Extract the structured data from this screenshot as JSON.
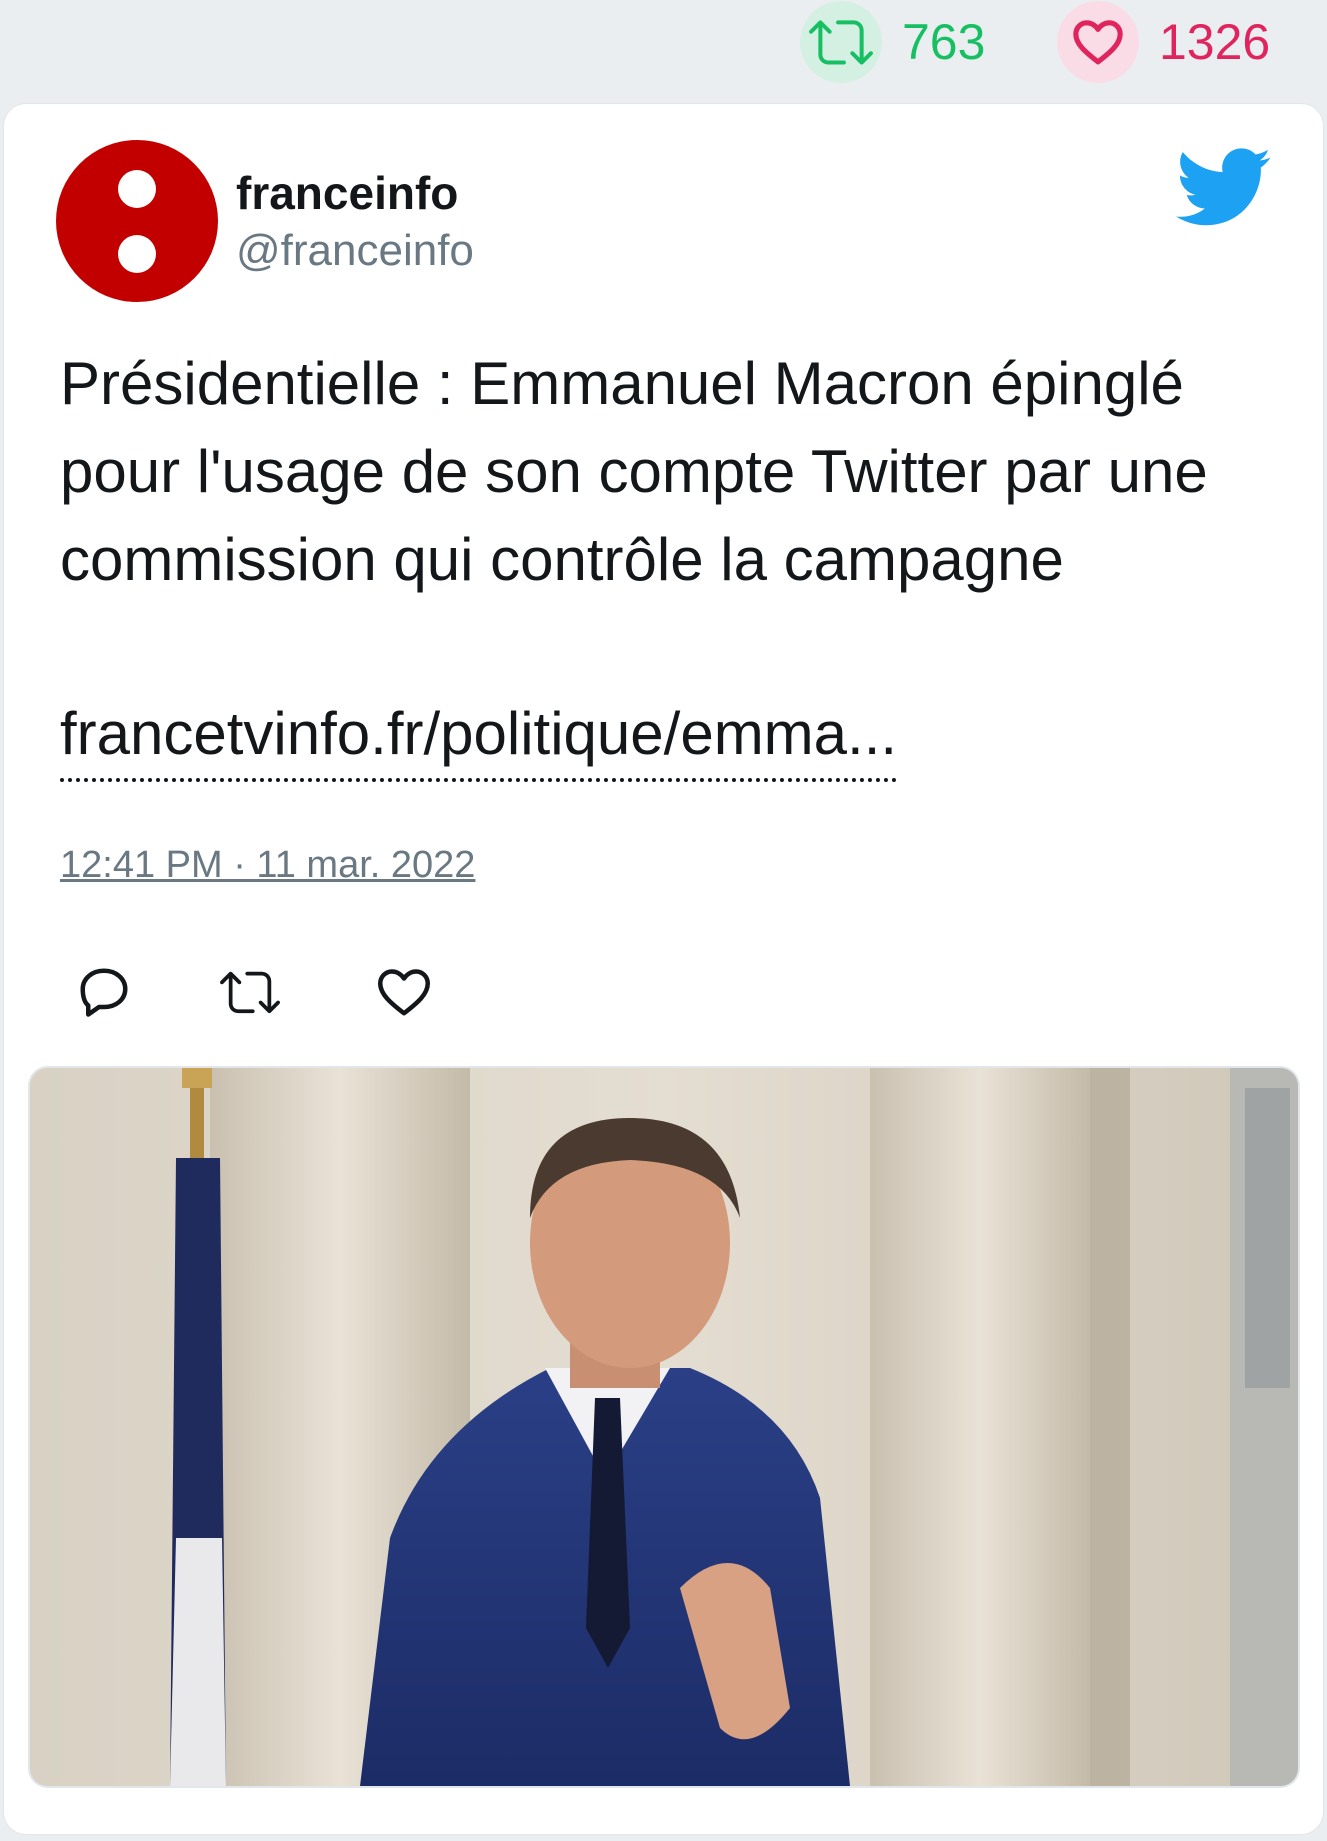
{
  "stats": {
    "retweets": "763",
    "likes": "1326"
  },
  "tweet": {
    "display_name": "franceinfo",
    "handle": "@franceinfo",
    "text": "Présidentielle : Emmanuel Macron épinglé pour l'usage de son compte Twitter par une commission qui contrôle la campagne",
    "link": "francetvinfo.fr/politique/emma...",
    "timestamp": "12:41 PM · 11 mar. 2022"
  },
  "icons": {
    "retweet": "retweet-icon",
    "like": "heart-icon",
    "reply": "reply-icon",
    "brand": "twitter-bird-icon",
    "avatar": "franceinfo-logo"
  },
  "colors": {
    "retweet": "#17bf63",
    "like": "#e0245e",
    "twitter_blue": "#1da1f2",
    "avatar_red": "#c20000",
    "secondary_text": "#697882"
  },
  "media": {
    "alt": "Photo of Emmanuel Macron in a blue suit with hands pressed together, standing at a stone doorway beside a flag"
  }
}
